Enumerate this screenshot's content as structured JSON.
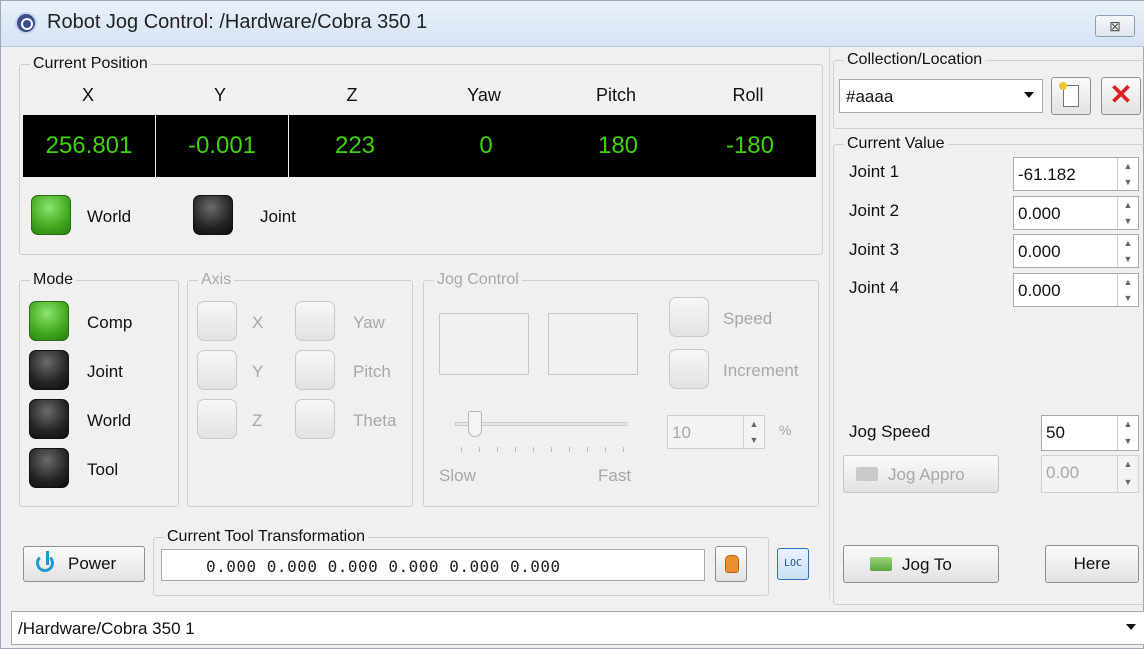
{
  "window": {
    "title": "Robot Jog Control: /Hardware/Cobra 350 1",
    "close_glyph": "⊠"
  },
  "current_position": {
    "legend": "Current Position",
    "columns": [
      {
        "label": "X",
        "value": "256.801"
      },
      {
        "label": "Y",
        "value": "-0.001"
      },
      {
        "label": "Z",
        "value": "223"
      },
      {
        "label": "Yaw",
        "value": "0"
      },
      {
        "label": "Pitch",
        "value": "180"
      },
      {
        "label": "Roll",
        "value": "-180"
      }
    ],
    "frame_world_label": "World",
    "frame_joint_label": "Joint",
    "frame_selected": "World"
  },
  "mode": {
    "legend": "Mode",
    "items": [
      {
        "label": "Comp",
        "active": true
      },
      {
        "label": "Joint",
        "active": false
      },
      {
        "label": "World",
        "active": false
      },
      {
        "label": "Tool",
        "active": false
      }
    ]
  },
  "axis": {
    "legend": "Axis",
    "left": [
      "X",
      "Y",
      "Z"
    ],
    "right": [
      "Yaw",
      "Pitch",
      "Theta"
    ]
  },
  "jog_control": {
    "legend": "Jog Control",
    "speed_label": "Speed",
    "increment_label": "Increment",
    "slow_label": "Slow",
    "fast_label": "Fast",
    "percent_value": "10",
    "percent_unit": "%"
  },
  "tool_transformation": {
    "legend": "Current Tool Transformation",
    "value": "0.000 0.000 0.000 0.000 0.000 0.000"
  },
  "power_button": "Power",
  "loc_button": "LOC",
  "collection": {
    "legend": "Collection/Location",
    "selected": "#aaaa"
  },
  "current_value": {
    "legend": "Current Value",
    "joints": [
      {
        "label": "Joint 1",
        "value": "-61.182"
      },
      {
        "label": "Joint 2",
        "value": "0.000"
      },
      {
        "label": "Joint 3",
        "value": "0.000"
      },
      {
        "label": "Joint 4",
        "value": "0.000"
      }
    ]
  },
  "jog_speed": {
    "label": "Jog Speed",
    "value": "50"
  },
  "jog_appro": {
    "label": "Jog Appro",
    "value": "0.00"
  },
  "jog_to_button": "Jog To",
  "here_button": "Here",
  "robot_selector": {
    "selected": "/Hardware/Cobra 350 1"
  },
  "colors": {
    "readout_bg": "#000000",
    "readout_text": "#3ed400",
    "led_green": "#3fa81f",
    "led_black": "#242424"
  }
}
